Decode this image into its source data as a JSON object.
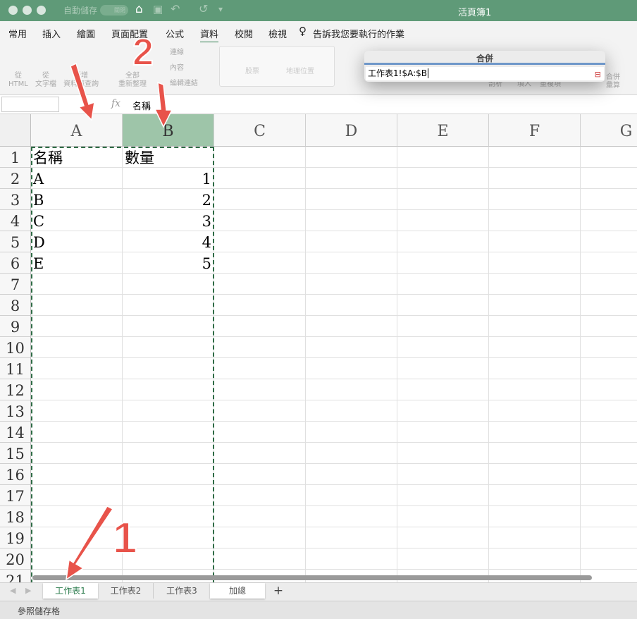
{
  "window": {
    "title": "活頁簿1",
    "autosave_label": "自動儲存",
    "autosave_state": "關閉"
  },
  "menu_tabs": [
    "常用",
    "插入",
    "繪圖",
    "頁面配置",
    "公式",
    "資料",
    "校閱",
    "檢視"
  ],
  "active_tab": "資料",
  "tell_me": "告訴我您要執行的作業",
  "ribbon": {
    "from_html": [
      "從",
      "HTML"
    ],
    "from_text": [
      "從",
      "文字檔"
    ],
    "new_query": [
      "新增",
      "資料庫查詢"
    ],
    "refresh_all": [
      "全部",
      "重新整理"
    ],
    "connections": "連線",
    "properties": "內容",
    "edit_links": "編輯連結",
    "stocks": "股票",
    "geography": "地理位置",
    "parse": "剖析",
    "fill": "填入",
    "duplicates": "重複項",
    "consolidate": [
      "合併",
      "彙算"
    ]
  },
  "formula_bar": {
    "name_box": "",
    "fx": "fx",
    "content": "名稱"
  },
  "columns": [
    "A",
    "B",
    "C",
    "D",
    "E",
    "F",
    "G"
  ],
  "selected_column": "B",
  "rows": [
    "1",
    "2",
    "3",
    "4",
    "5",
    "6",
    "7",
    "8",
    "9",
    "10",
    "11",
    "12",
    "13",
    "14",
    "15",
    "16",
    "17",
    "18",
    "19",
    "20",
    "21"
  ],
  "cells": [
    [
      "名稱",
      "數量"
    ],
    [
      "A",
      "1"
    ],
    [
      "B",
      "2"
    ],
    [
      "C",
      "3"
    ],
    [
      "D",
      "4"
    ],
    [
      "E",
      "5"
    ]
  ],
  "dialog": {
    "title": "合併",
    "value": "工作表1!$A:$B"
  },
  "sheet_tabs": [
    "工作表1",
    "工作表2",
    "工作表3",
    "加總"
  ],
  "active_sheet": "工作表1",
  "add_sheet": "+",
  "status_text": "參照儲存格",
  "annotations": [
    "1",
    "2"
  ],
  "colors": {
    "titlebar": "#5f9a78",
    "accent": "#2e7d4f",
    "annotation": "#e8534a"
  }
}
